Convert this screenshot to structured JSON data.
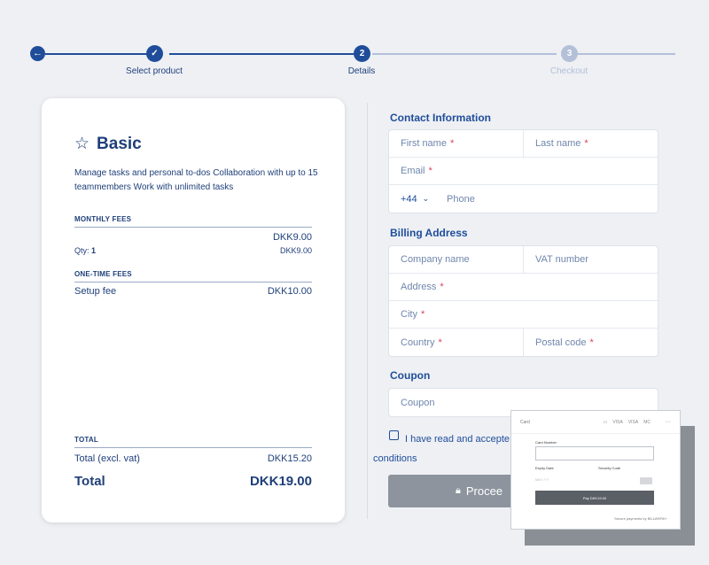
{
  "stepper": {
    "back_icon": "back-arrow-icon",
    "steps": [
      {
        "label": "Select product",
        "number": "",
        "icon": "check-icon",
        "state": "done"
      },
      {
        "label": "Details",
        "number": "2",
        "state": "current"
      },
      {
        "label": "Checkout",
        "number": "3",
        "state": "upcoming"
      }
    ]
  },
  "product": {
    "icon": "star-icon",
    "name": "Basic",
    "description": "Manage tasks and personal to-dos Collaboration with up to 15 teammembers Work with unlimited tasks",
    "monthly_heading": "MONTHLY FEES",
    "monthly_total": "DKK9.00",
    "qty_label": "Qty:",
    "qty_value": "1",
    "qty_price": "DKK9.00",
    "onetime_heading": "ONE-TIME FEES",
    "setup_label": "Setup fee",
    "setup_price": "DKK10.00",
    "total_heading": "TOTAL",
    "total_excl_label": "Total (excl. vat)",
    "total_excl_value": "DKK15.20",
    "total_label": "Total",
    "total_value": "DKK19.00"
  },
  "contact": {
    "heading": "Contact Information",
    "first_name": "First name",
    "last_name": "Last name",
    "email": "Email",
    "phone_prefix": "+44",
    "phone": "Phone",
    "required_mark": "*"
  },
  "billing": {
    "heading": "Billing Address",
    "company": "Company name",
    "vat": "VAT number",
    "address": "Address",
    "city": "City",
    "country": "Country",
    "postal": "Postal code"
  },
  "coupon": {
    "heading": "Coupon",
    "placeholder": "Coupon"
  },
  "terms": {
    "text": "I have read and accepted the terms and conditions",
    "visible_line1": "I have read and accepte",
    "visible_line2": "conditions"
  },
  "proceed": {
    "label": "Procee",
    "icon": "lock-icon"
  },
  "payment": {
    "tab": "Card",
    "brands": [
      "VISA",
      "VISA",
      "MC"
    ],
    "more": "···",
    "card_number_label": "Card Number",
    "expiry_label": "Expiry Date",
    "expiry_placeholder": "MM / YY",
    "security_label": "Security Code",
    "pay_button": "Pay DKK19.00",
    "secure_text": "Secure payments by BILLWERK+"
  },
  "colors": {
    "primary": "#1f4d9a",
    "inactive": "#b3c0d8",
    "required": "#d9425a",
    "button_disabled": "#8d949d"
  }
}
